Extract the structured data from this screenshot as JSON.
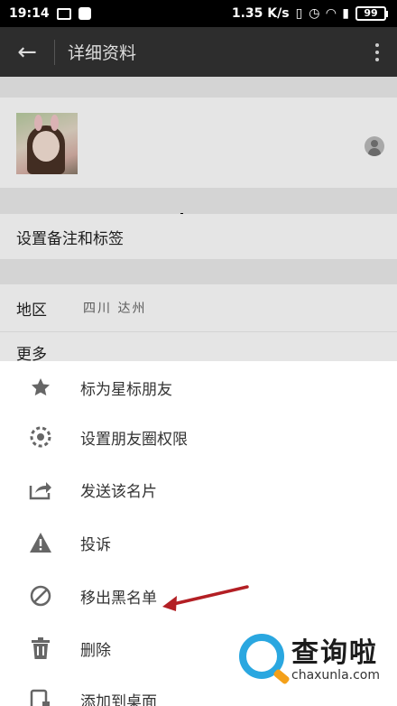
{
  "status_bar": {
    "time": "19:14",
    "network_speed": "1.35 K/s",
    "battery_level": "99"
  },
  "app_bar": {
    "back_icon": "arrow-left-icon",
    "title": "详细资料",
    "more_icon": "more-vertical-icon"
  },
  "profile": {
    "remark_label": "设置备注和标签",
    "region_label": "地区",
    "region_value": "四川 达州",
    "more_label": "更多"
  },
  "menu": {
    "items": [
      {
        "icon": "star-icon",
        "label": "标为星标朋友"
      },
      {
        "icon": "aperture-icon",
        "label": "设置朋友圈权限"
      },
      {
        "icon": "share-icon",
        "label": "发送该名片"
      },
      {
        "icon": "warning-icon",
        "label": "投诉"
      },
      {
        "icon": "block-icon",
        "label": "移出黑名单"
      },
      {
        "icon": "trash-icon",
        "label": "删除"
      },
      {
        "icon": "add-to-desktop-icon",
        "label": "添加到桌面"
      }
    ]
  },
  "annotation": {
    "arrow_color": "#b31f24"
  },
  "watermark": {
    "title": "查询啦",
    "url": "chaxunla.com"
  }
}
